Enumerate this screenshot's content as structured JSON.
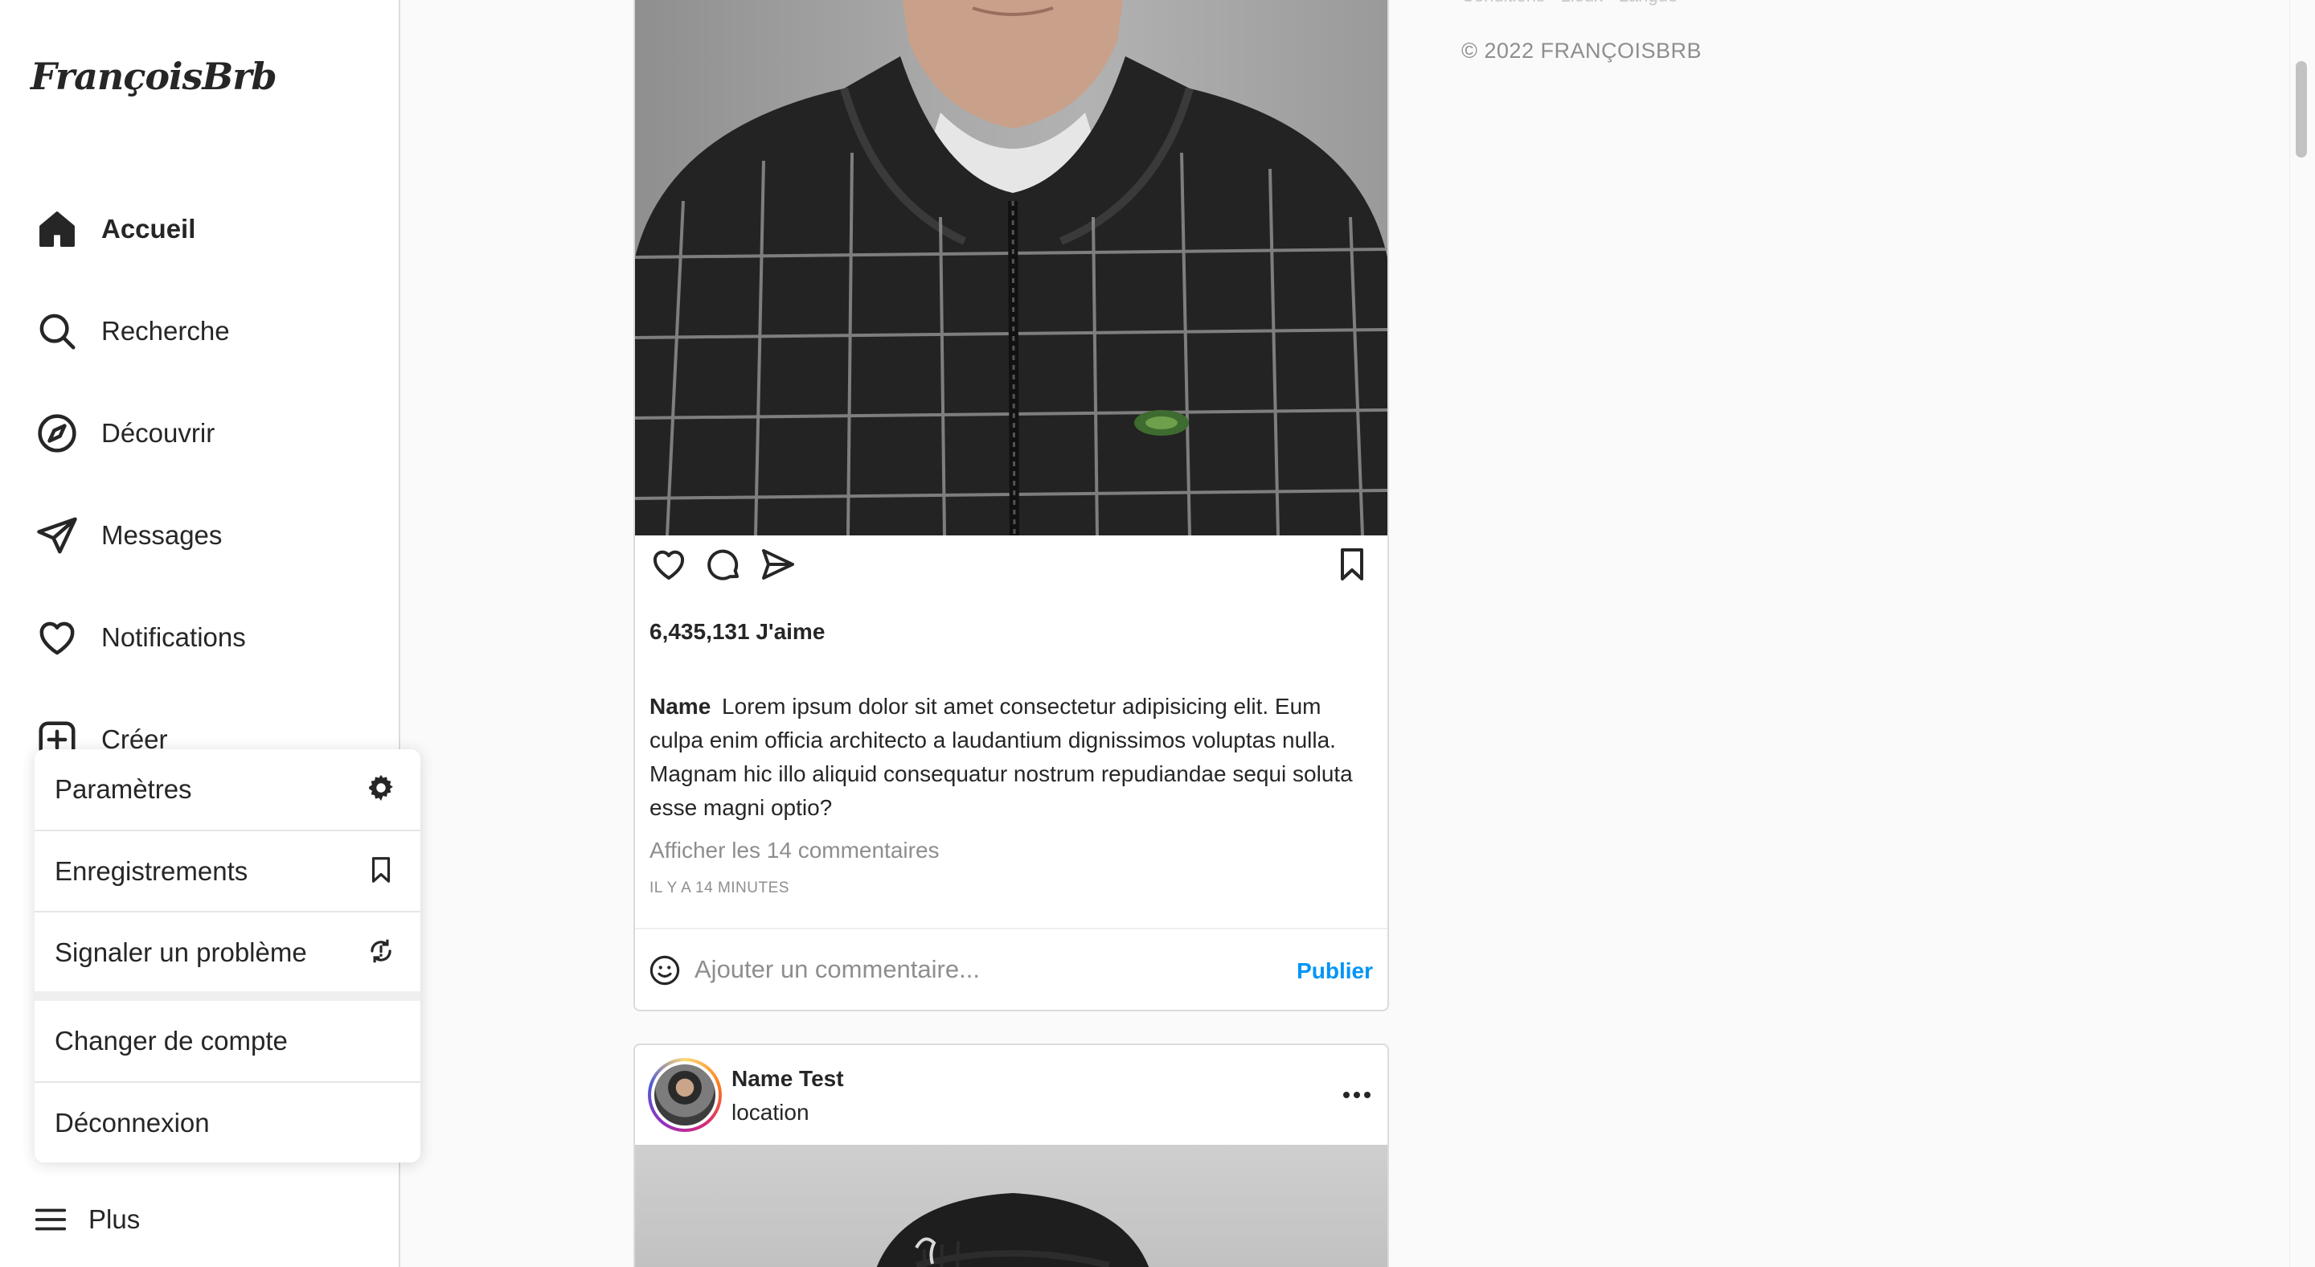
{
  "brand": {
    "logo_text": "FrançoisBrb"
  },
  "nav": {
    "items": [
      {
        "label": "Accueil",
        "icon": "home-icon"
      },
      {
        "label": "Recherche",
        "icon": "search-icon"
      },
      {
        "label": "Découvrir",
        "icon": "compass-icon"
      },
      {
        "label": "Messages",
        "icon": "paper-plane-icon"
      },
      {
        "label": "Notifications",
        "icon": "heart-icon"
      },
      {
        "label": "Créer",
        "icon": "plus-square-icon"
      }
    ],
    "more": {
      "label": "Plus",
      "icon": "hamburger-icon"
    }
  },
  "more_menu": {
    "items": [
      {
        "label": "Paramètres",
        "icon": "gear-icon"
      },
      {
        "label": "Enregistrements",
        "icon": "bookmark-icon"
      },
      {
        "label": "Signaler un problème",
        "icon": "report-icon"
      },
      {
        "label": "Changer de compte"
      },
      {
        "label": "Déconnexion"
      }
    ]
  },
  "post1": {
    "likes": "6,435,131 J'aime",
    "caption_user": "Name",
    "caption_text": "Lorem ipsum dolor sit amet consectetur adipisicing elit. Eum culpa enim officia architecto a laudantium dignissimos voluptas nulla. Magnam hic illo aliquid consequatur nostrum repudiandae sequi soluta esse magni optio?",
    "view_comments": "Afficher les 14 commentaires",
    "timestamp": "IL Y A 14 MINUTES",
    "comment_placeholder": "Ajouter un commentaire...",
    "publish_label": "Publier"
  },
  "post2": {
    "username": "Name Test",
    "location": "location"
  },
  "sidebar_right": {
    "footer_links": "Conditions · Lieux · Langue ·",
    "copyright": "© 2022 FRANÇOISBRB"
  },
  "colors": {
    "accent": "#0095f6",
    "text": "#262626",
    "muted": "#8e8e8e",
    "border": "#dbdbdb",
    "background": "#fafafa"
  }
}
